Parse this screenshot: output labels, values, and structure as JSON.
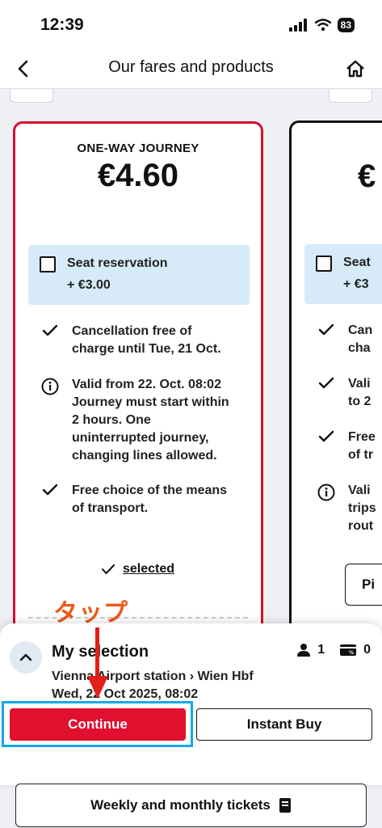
{
  "status_bar": {
    "time": "12:39",
    "battery": "83"
  },
  "header": {
    "title": "Our fares and products"
  },
  "cards": [
    {
      "label": "ONE-WAY JOURNEY",
      "price": "€4.60",
      "seat_reservation": {
        "title": "Seat reservation",
        "price": "+ €3.00"
      },
      "features": [
        {
          "icon": "check-icon",
          "lines": [
            "Cancellation free of",
            "charge until Tue, 21 Oct."
          ]
        },
        {
          "icon": "info-icon",
          "lines": [
            "Valid from 22. Oct. 08:02",
            "Journey must start within",
            "2 hours. One",
            "uninterrupted journey,",
            "changing lines allowed."
          ]
        },
        {
          "icon": "check-icon",
          "lines": [
            "Free choice of the means",
            "of transport."
          ]
        }
      ],
      "selected_label": "selected"
    },
    {
      "price": "€",
      "seat_reservation": {
        "title": "Seat",
        "price": "+ €3"
      },
      "features": [
        {
          "icon": "check-icon",
          "lines": [
            "Can",
            "cha"
          ]
        },
        {
          "icon": "check-icon",
          "lines": [
            "Vali",
            "to 2"
          ]
        },
        {
          "icon": "check-icon",
          "lines": [
            "Free",
            "of tr"
          ]
        },
        {
          "icon": "info-icon",
          "lines": [
            "Vali",
            "trips",
            "rout"
          ]
        }
      ],
      "button_label": "Pi"
    }
  ],
  "annotation": {
    "text": "タップ",
    "color": "#ea5a1c",
    "highlight_color": "#12a8e8"
  },
  "selection": {
    "title": "My selection",
    "passengers": "1",
    "cards": "0",
    "route": "Vienna Airport station › Wien Hbf",
    "datetime": "Wed, 22 Oct 2025, 08:02",
    "continue_label": "Continue",
    "instant_buy_label": "Instant Buy"
  },
  "weekly_button": {
    "label": "Weekly and monthly tickets"
  },
  "colors": {
    "brand_red": "#e0102e",
    "seat_box": "#d6ebf7"
  }
}
